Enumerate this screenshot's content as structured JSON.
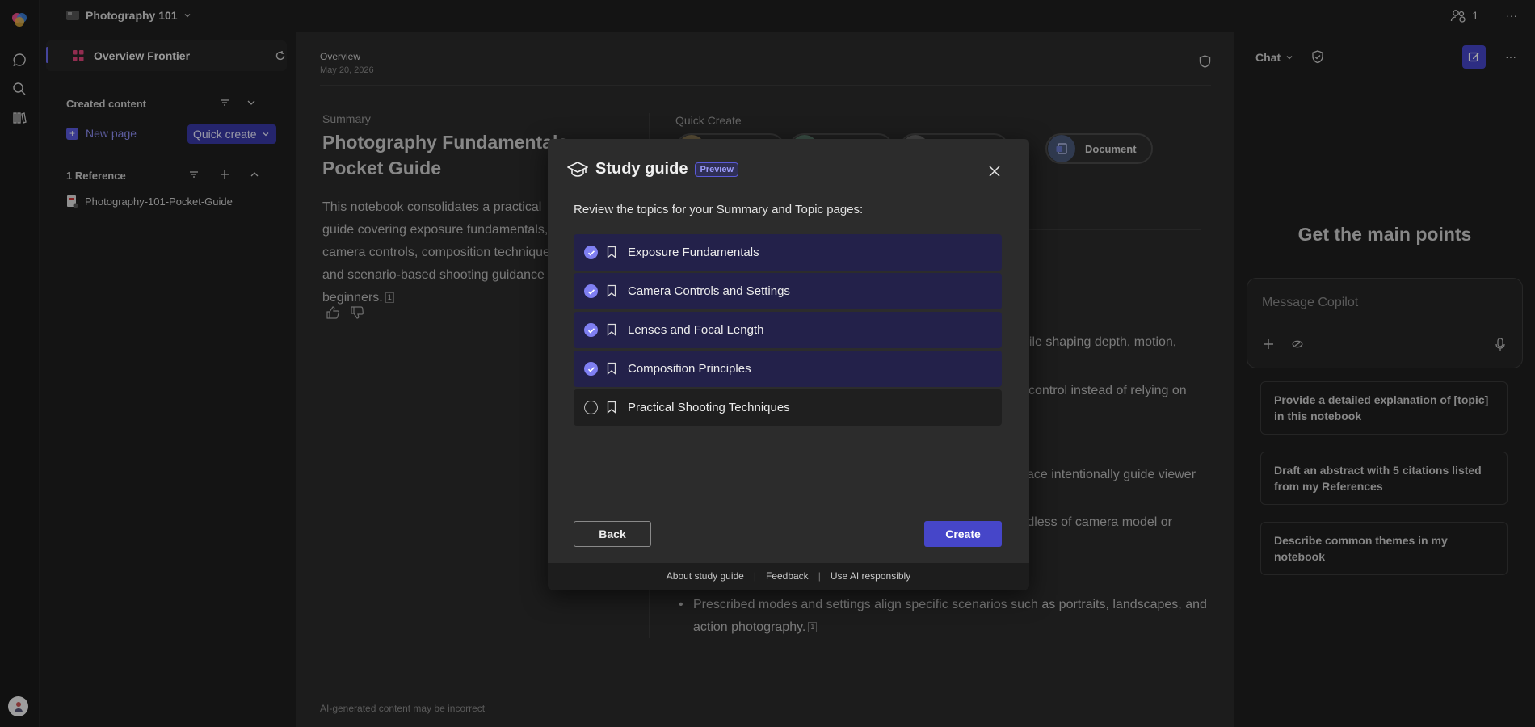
{
  "topbar": {
    "notebook_title": "Photography 101",
    "people_count": "1",
    "more": "···"
  },
  "nav": {
    "header_title": "Overview Frontier",
    "created_title": "Created content",
    "new_page": "New page",
    "quick_create": "Quick create",
    "references_title": "1 Reference",
    "reference_item": "Photography-101-Pocket-Guide"
  },
  "main": {
    "overview_label": "Overview",
    "date": "May 20, 2026",
    "summary_label": "Summary",
    "summary_title": "Photography Fundamentals Pocket Guide",
    "summary_body": "This notebook consolidates a practical guide covering exposure fundamentals, camera controls, composition techniques, and scenario-based shooting guidance for beginners.",
    "cite": "1",
    "quick_create_label": "Quick Create",
    "chip_document": "Document",
    "frag1": "hile shaping depth, motion,",
    "frag2": "control instead of relying on",
    "frag3": "ace intentionally guide viewer",
    "frag4": "rdless of camera model or",
    "bullet": "Prescribed modes and settings align specific scenarios such as portraits, landscapes, and action photography.",
    "footer": "AI-generated content may be incorrect"
  },
  "chat": {
    "title": "Chat",
    "heading": "Get the main points",
    "placeholder": "Message Copilot",
    "suggestions": [
      "Provide a detailed explanation of [topic] in this notebook",
      "Draft an abstract with 5 citations listed from my References",
      "Describe common themes in my notebook"
    ]
  },
  "modal": {
    "title": "Study guide",
    "badge": "Preview",
    "subtitle": "Review the topics for your Summary and Topic pages:",
    "topics": [
      {
        "label": "Exposure Fundamentals",
        "checked": true
      },
      {
        "label": "Camera Controls and Settings",
        "checked": true
      },
      {
        "label": "Lenses and Focal Length",
        "checked": true
      },
      {
        "label": "Composition Principles",
        "checked": true
      },
      {
        "label": "Practical Shooting Techniques",
        "checked": false
      }
    ],
    "back": "Back",
    "create": "Create",
    "links": [
      "About study guide",
      "Feedback",
      "Use AI responsibly"
    ]
  },
  "colors": {
    "accent": "#4646c9",
    "selected_row": "#23214a",
    "check": "#7f7ff2"
  }
}
